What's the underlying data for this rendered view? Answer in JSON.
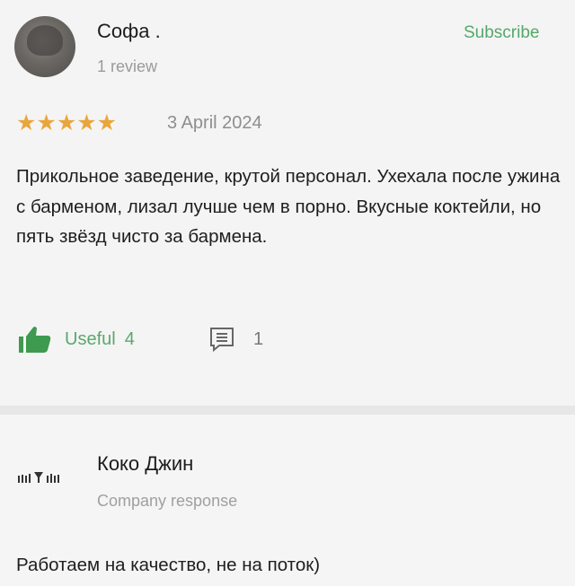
{
  "review": {
    "author_name": "Софа .",
    "review_count": "1 review",
    "subscribe_label": "Subscribe",
    "rating": 5,
    "stars": "★★★★★",
    "date": "3 April 2024",
    "text": "Прикольное заведение, крутой персонал. Ухехала после ужина с барменом, лизал лучше чем в порно. Вкусные коктейли, но пять звёзд чисто за бармена.",
    "useful_label": "Useful",
    "useful_count": "4",
    "comment_count": "1"
  },
  "response": {
    "company_name": "Коко Джин",
    "label": "Company response",
    "text": "Работаем на качество, не на поток)"
  },
  "colors": {
    "accent_green": "#5aa86d",
    "star_orange": "#e9a63c"
  },
  "icons": [
    "avatar",
    "star-icon",
    "thumbs-up-icon",
    "comment-icon",
    "company-logo"
  ]
}
